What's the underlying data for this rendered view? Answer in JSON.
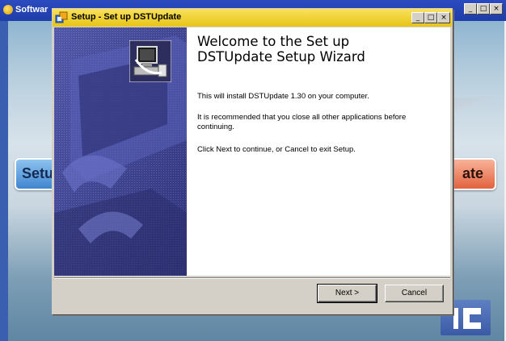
{
  "background_window": {
    "title": "Softwar",
    "setup_button_label": "Setu",
    "update_button_label": "ate",
    "controls": {
      "minimize": "_",
      "maximize": "□",
      "close": "×"
    }
  },
  "dialog": {
    "title": "Setup - Set up DSTUpdate",
    "controls": {
      "minimize": "_",
      "maximize": "□",
      "close": "×"
    },
    "heading": "Welcome to the Set up\nDSTUpdate Setup Wizard",
    "paragraphs": {
      "install": "This will install DSTUpdate 1.30 on your computer.",
      "recommend": "It is recommended that you close all other applications before continuing.",
      "instructions": "Click Next to continue, or Cancel to exit Setup."
    },
    "buttons": {
      "next": "Next >",
      "cancel": "Cancel"
    }
  },
  "colors": {
    "dialog_titlebar": "#f2d236",
    "side_panel": "#3a3d8a",
    "bg_titlebar": "#2b4bbf"
  },
  "icons": [
    "setup-app-icon",
    "wizard-computer-icon",
    "software-app-icon"
  ]
}
